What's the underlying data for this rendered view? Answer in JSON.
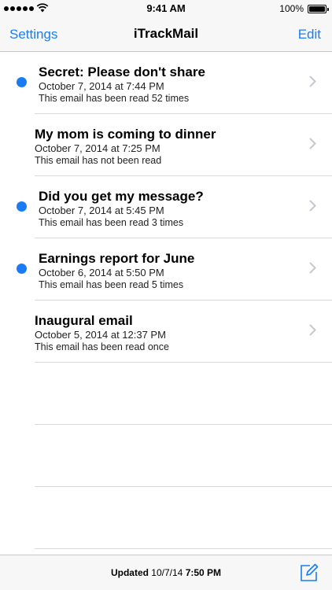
{
  "status_bar": {
    "time": "9:41 AM",
    "battery": "100%"
  },
  "nav": {
    "left_label": "Settings",
    "title": "iTrackMail",
    "right_label": "Edit"
  },
  "emails": [
    {
      "subject": "Secret: Please don't share",
      "date": "October 7, 2014 at 7:44 PM",
      "status": "This email has been read 52 times",
      "unread": true
    },
    {
      "subject": "My mom is coming to dinner",
      "date": "October 7, 2014 at 7:25 PM",
      "status": "This email has not been read",
      "unread": false
    },
    {
      "subject": "Did you get my message?",
      "date": "October 7, 2014 at 5:45 PM",
      "status": "This email has been read 3 times",
      "unread": true
    },
    {
      "subject": "Earnings report for June",
      "date": "October 6, 2014 at 5:50 PM",
      "status": "This email has been read 5 times",
      "unread": true
    },
    {
      "subject": "Inaugural email",
      "date": "October 5, 2014 at 12:37 PM",
      "status": "This email has been read once",
      "unread": false
    }
  ],
  "toolbar": {
    "updated_label": "Updated",
    "updated_date": "10/7/14",
    "updated_time": "7:50 PM"
  },
  "colors": {
    "accent": "#1a7cf5",
    "bar_background": "#f7f7f8",
    "separator": "#d9d9dd"
  },
  "icons": {
    "signal": "signal-dots-icon",
    "wifi": "wifi-icon",
    "battery": "battery-icon",
    "chevron": "chevron-right-icon",
    "compose": "compose-icon"
  }
}
